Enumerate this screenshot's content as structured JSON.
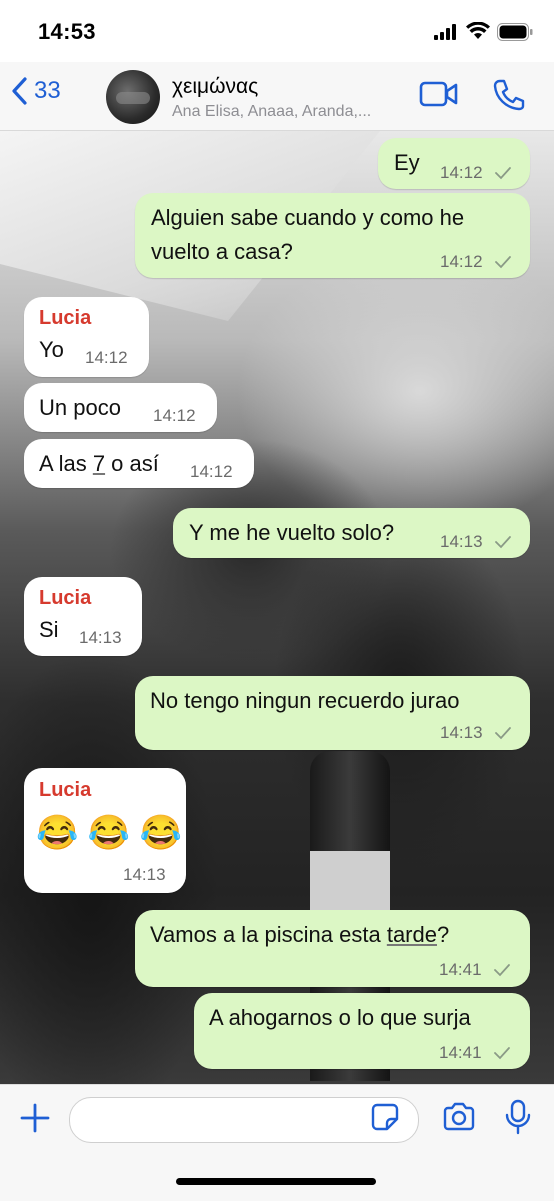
{
  "status_bar": {
    "time": "14:53"
  },
  "header": {
    "back_count": "33",
    "group_name": "χειμώνας",
    "participants": "Ana Elisa, Anaaa, Aranda,..."
  },
  "messages": [
    {
      "dir": "out",
      "text": "Ey",
      "time": "14:12"
    },
    {
      "dir": "out",
      "line1": "Alguien sabe cuando y como he",
      "line2": "vuelto a casa?",
      "time": "14:12"
    },
    {
      "dir": "in",
      "sender": "Lucia",
      "text": "Yo",
      "time": "14:12"
    },
    {
      "dir": "in",
      "text": "Un poco",
      "time": "14:12"
    },
    {
      "dir": "in",
      "text_pre": "A las ",
      "text_link": "7",
      "text_post": " o así",
      "time": "14:12"
    },
    {
      "dir": "out",
      "text": "Y me he vuelto solo?",
      "time": "14:13"
    },
    {
      "dir": "in",
      "sender": "Lucia",
      "text": "Si",
      "time": "14:13"
    },
    {
      "dir": "out",
      "text": "No tengo ningun recuerdo jurao",
      "time": "14:13"
    },
    {
      "dir": "in",
      "sender": "Lucia",
      "text": "😂 😂 😂",
      "time": "14:13"
    },
    {
      "dir": "out",
      "text_pre": "Vamos a la piscina esta ",
      "text_link": "tarde",
      "text_post": "?",
      "time": "14:41"
    },
    {
      "dir": "out",
      "text": "A ahogarnos o lo que surja",
      "time": "14:41"
    }
  ],
  "input": {
    "placeholder": ""
  },
  "colors": {
    "accent": "#1f5fd4",
    "outgoing": "#dcf7c5",
    "incoming": "#ffffff",
    "sender": "#d63a2e"
  }
}
